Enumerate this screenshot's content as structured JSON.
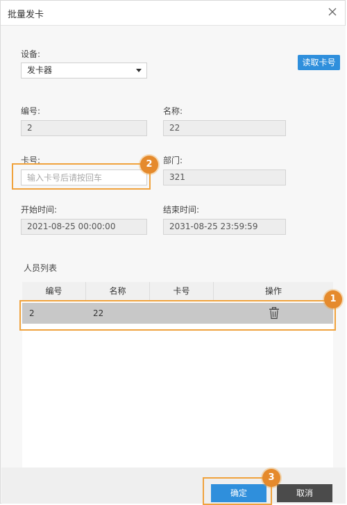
{
  "dialog": {
    "title": "批量发卡",
    "close_icon": "close-icon"
  },
  "device": {
    "label": "设备:",
    "selected": "发卡器",
    "read_button": "读取卡号"
  },
  "fields": {
    "number_label": "编号:",
    "number_value": "2",
    "name_label": "名称:",
    "name_value": "22",
    "card_label": "卡号:",
    "card_placeholder": "输入卡号后请按回车",
    "card_value": "",
    "dept_label": "部门:",
    "dept_value": "321",
    "start_label": "开始时间:",
    "start_value": "2021-08-25 00:00:00",
    "end_label": "结束时间:",
    "end_value": "2031-08-25 23:59:59"
  },
  "person_list": {
    "title": "人员列表",
    "columns": [
      "编号",
      "名称",
      "卡号",
      "操作"
    ],
    "rows": [
      {
        "number": "2",
        "name": "22",
        "card": "",
        "action_icon": "trash-icon"
      }
    ]
  },
  "footer": {
    "confirm": "确定",
    "cancel": "取消"
  },
  "callouts": {
    "one": "1",
    "two": "2",
    "three": "3"
  },
  "colors": {
    "accent_blue": "#2f8fdc",
    "callout_orange": "#e58a2c",
    "selected_row": "#c8c8c8"
  }
}
